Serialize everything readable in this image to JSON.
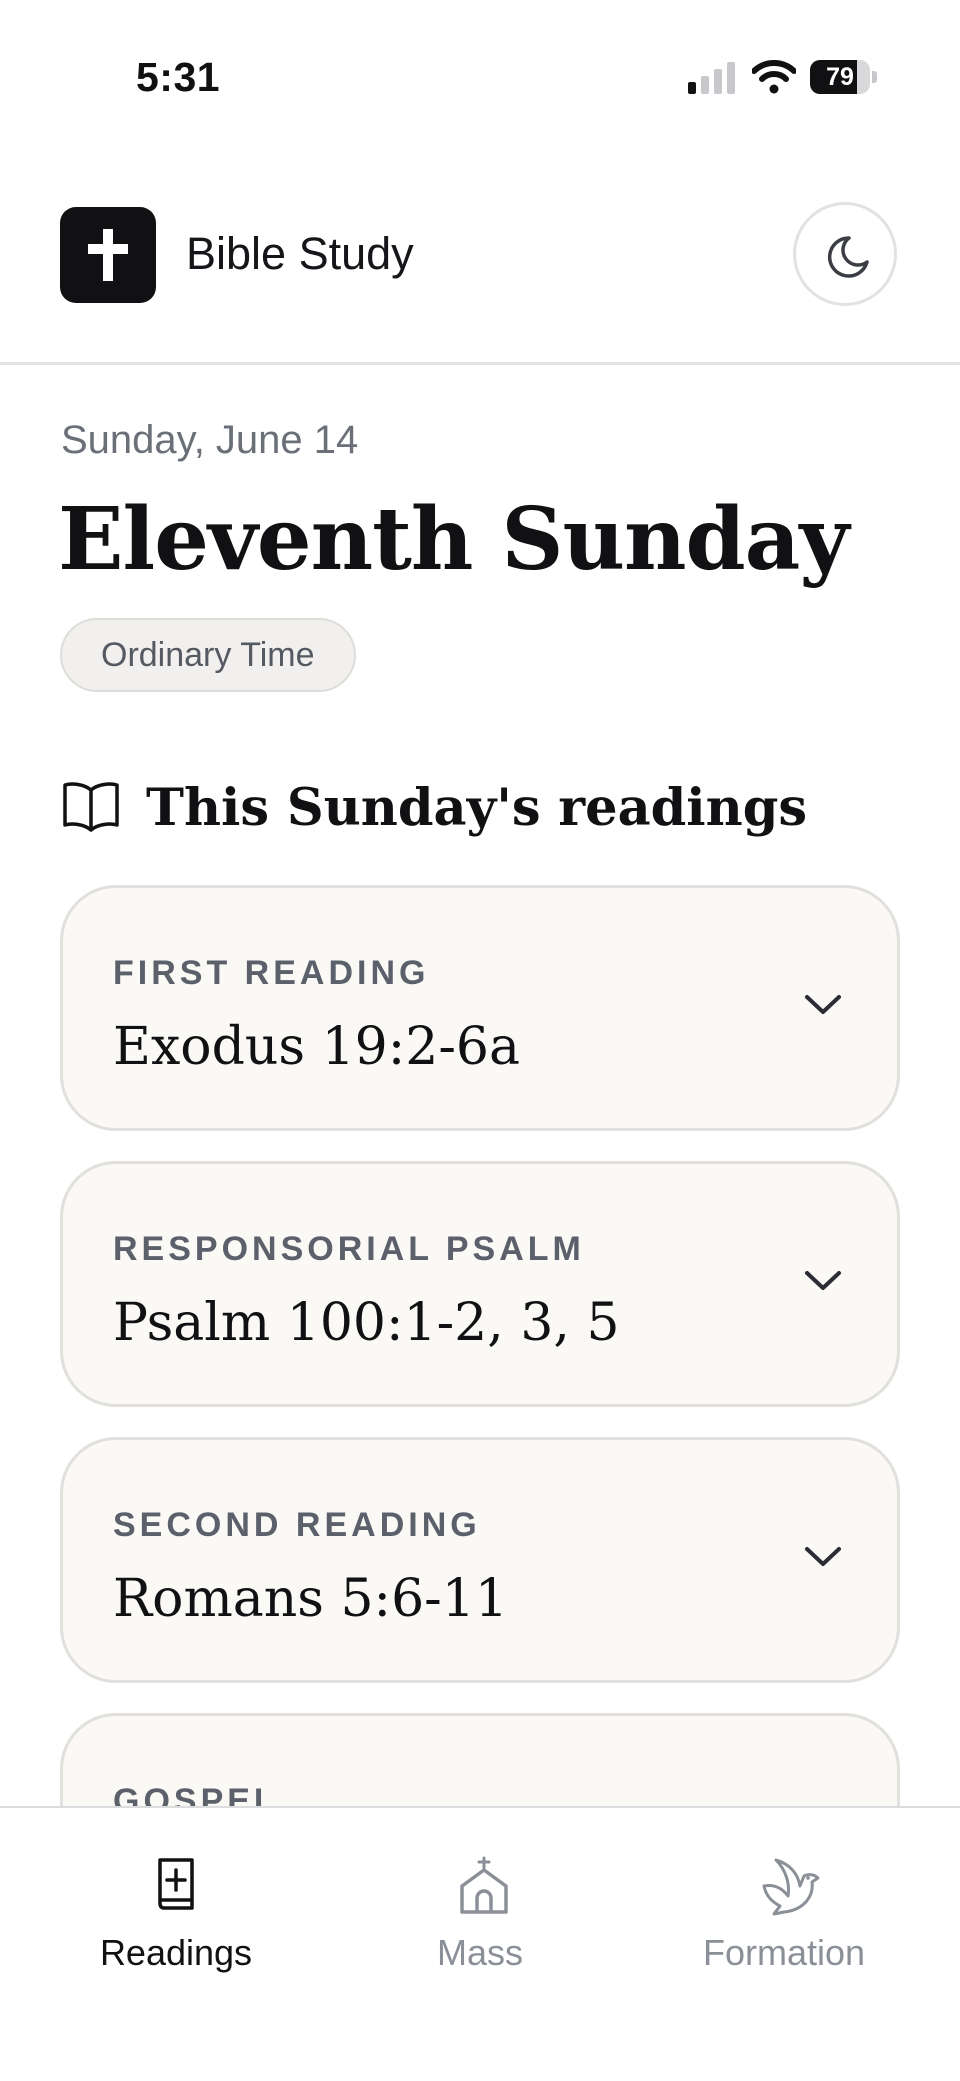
{
  "status_bar": {
    "time": "5:31",
    "battery_percent": 79,
    "battery_text": "79"
  },
  "header": {
    "app_title": "Bible Study"
  },
  "main": {
    "date": "Sunday, June 14",
    "title": "Eleventh Sunday",
    "season_badge": "Ordinary Time",
    "section_title": "This Sunday's readings",
    "readings": [
      {
        "label": "FIRST READING",
        "reference": "Exodus 19:2-6a"
      },
      {
        "label": "RESPONSORIAL PSALM",
        "reference": "Psalm 100:1-2, 3, 5"
      },
      {
        "label": "SECOND READING",
        "reference": "Romans 5:6-11"
      },
      {
        "label": "GOSPEL",
        "reference": ""
      }
    ]
  },
  "tab_bar": {
    "tabs": [
      {
        "label": "Readings",
        "icon": "bible-icon",
        "active": true
      },
      {
        "label": "Mass",
        "icon": "church-icon",
        "active": false
      },
      {
        "label": "Formation",
        "icon": "dove-icon",
        "active": false
      }
    ]
  },
  "colors": {
    "active_tab": "#111114",
    "inactive_tab": "#8b8f97",
    "card_background": "#faf9f6"
  }
}
